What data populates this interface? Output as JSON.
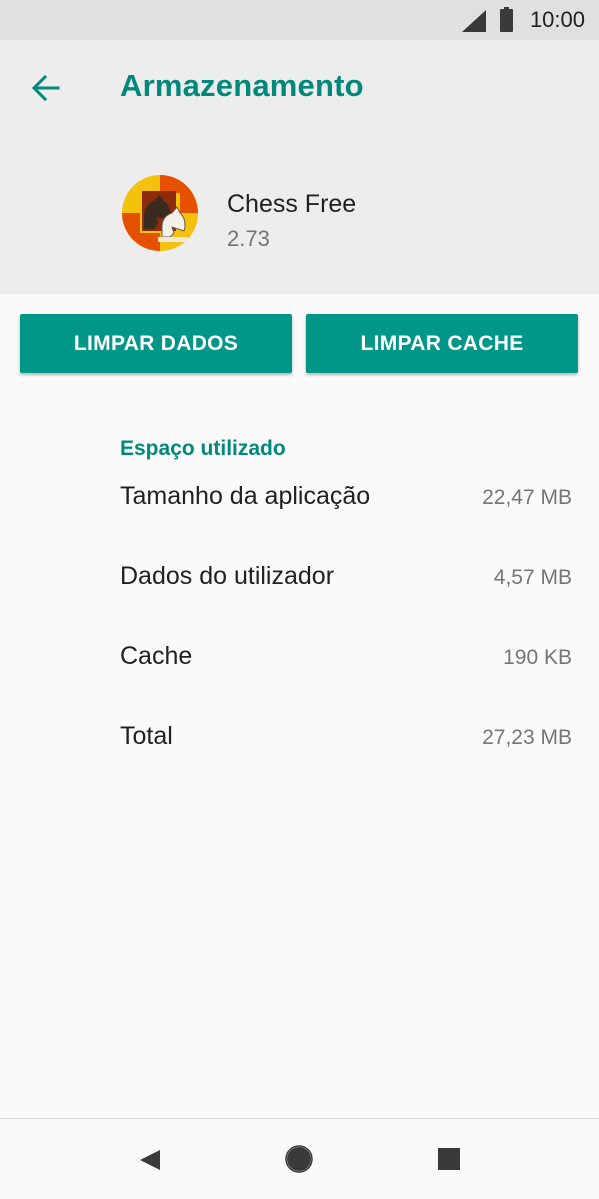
{
  "status_bar": {
    "time": "10:00",
    "icons": [
      "signal-icon",
      "battery-icon"
    ]
  },
  "header": {
    "title": "Armazenamento",
    "back_icon": "arrow-back-icon",
    "accent_color": "#00897b"
  },
  "app": {
    "name": "Chess Free",
    "version": "2.73",
    "icon": "chess-knight-icon"
  },
  "buttons": {
    "clear_data": "LIMPAR DADOS",
    "clear_cache": "LIMPAR CACHE",
    "color": "#009688"
  },
  "storage": {
    "section_title": "Espaço utilizado",
    "rows": [
      {
        "label": "Tamanho da aplicação",
        "value": "22,47 MB"
      },
      {
        "label": "Dados do utilizador",
        "value": "4,57 MB"
      },
      {
        "label": "Cache",
        "value": "190 KB"
      },
      {
        "label": "Total",
        "value": "27,23 MB"
      }
    ]
  },
  "nav_bar": {
    "icons": [
      "nav-back-icon",
      "nav-home-icon",
      "nav-recents-icon"
    ]
  }
}
